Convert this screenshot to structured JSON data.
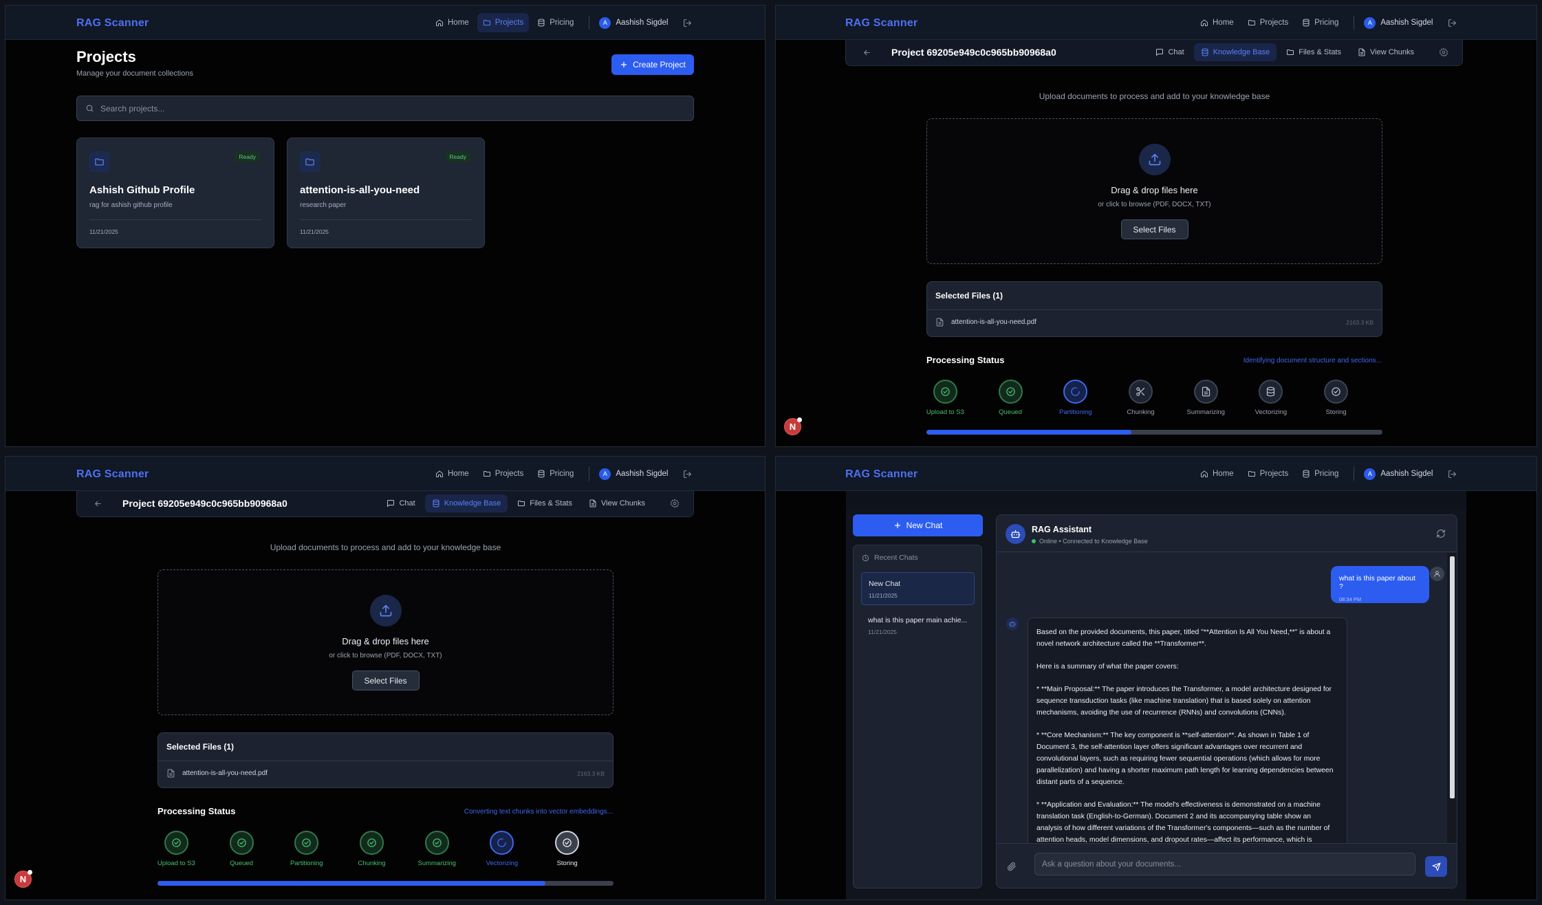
{
  "nav": {
    "brand": "RAG Scanner",
    "home": "Home",
    "projects": "Projects",
    "pricing": "Pricing",
    "user_initial": "A",
    "user_name": "Aashish Sigdel"
  },
  "projects_page": {
    "title": "Projects",
    "subtitle": "Manage your document collections",
    "create_button": "Create Project",
    "search_placeholder": "Search projects...",
    "cards": [
      {
        "title": "Ashish Github Profile",
        "description": "rag for ashish github profile",
        "status": "Ready",
        "date": "11/21/2025"
      },
      {
        "title": "attention-is-all-you-need",
        "description": "research paper",
        "status": "Ready",
        "date": "11/21/2025"
      }
    ]
  },
  "project": {
    "title": "Project 69205e949c0c965bb90968a0",
    "tabs": {
      "chat": "Chat",
      "knowledge_base": "Knowledge Base",
      "files_stats": "Files & Stats",
      "view_chunks": "View Chunks"
    }
  },
  "upload": {
    "subtitle": "Upload documents to process and add to your knowledge base",
    "drop_title": "Drag & drop files here",
    "drop_sub": "or click to browse (PDF, DOCX, TXT)",
    "select_button": "Select Files",
    "selected_header": "Selected Files (1)",
    "file_name": "attention-is-all-you-need.pdf",
    "file_size": "2163.3 KB"
  },
  "processing": {
    "title": "Processing Status",
    "steps": [
      "Upload to S3",
      "Queued",
      "Partitioning",
      "Chunking",
      "Summarizing",
      "Vectorizing",
      "Storing"
    ],
    "pane_a": {
      "message": "Identifying document structure and sections...",
      "progress": 0.45,
      "states": [
        "done",
        "done",
        "active",
        "pending",
        "pending",
        "pending",
        "pending"
      ]
    },
    "pane_b": {
      "message": "Converting text chunks into vector embeddings...",
      "progress": 0.85,
      "states": [
        "done",
        "done",
        "done",
        "done",
        "done",
        "active",
        "pending"
      ]
    }
  },
  "notification_letter": "N",
  "chat": {
    "new_chat_button": "New Chat",
    "recent_header": "Recent Chats",
    "recent": [
      {
        "title": "New Chat",
        "date": "11/21/2025"
      },
      {
        "title": "what is this paper main achie...",
        "date": "11/21/2025"
      }
    ],
    "assistant_name": "RAG Assistant",
    "assistant_status": "Online • Connected to Knowledge Base",
    "user_message": "what is this paper about ?",
    "user_time": "08:34 PM",
    "bot_paragraphs": [
      "Based on the provided documents, this paper, titled \"**Attention Is All You Need,**\" is about a novel network architecture called the **Transformer**.",
      "Here is a summary of what the paper covers:",
      "*   **Main Proposal:** The paper introduces the Transformer, a model architecture designed for sequence transduction tasks (like machine translation) that is based solely on attention mechanisms, avoiding the use of recurrence (RNNs) and convolutions (CNNs).",
      "*   **Core Mechanism:** The key component is **self-attention**. As shown in Table 1 of Document 3, the self-attention layer offers significant advantages over recurrent and convolutional layers, such as requiring fewer sequential operations (which allows for more parallelization) and having a shorter maximum path length for learning dependencies between distant parts of a sequence.",
      "*   **Application and Evaluation:** The model's effectiveness is demonstrated on a machine translation task (English-to-German). Document 2 and its accompanying table show an analysis of how different variations of the Transformer's components—such as the number of attention heads, model dimensions, and dropout rates—affect its performance, which is measured in"
    ],
    "input_placeholder": "Ask a question about your documents..."
  },
  "colors": {
    "accent": "#2d5df0",
    "success": "#47c070",
    "background": "#030303",
    "panel": "#1c2230"
  }
}
